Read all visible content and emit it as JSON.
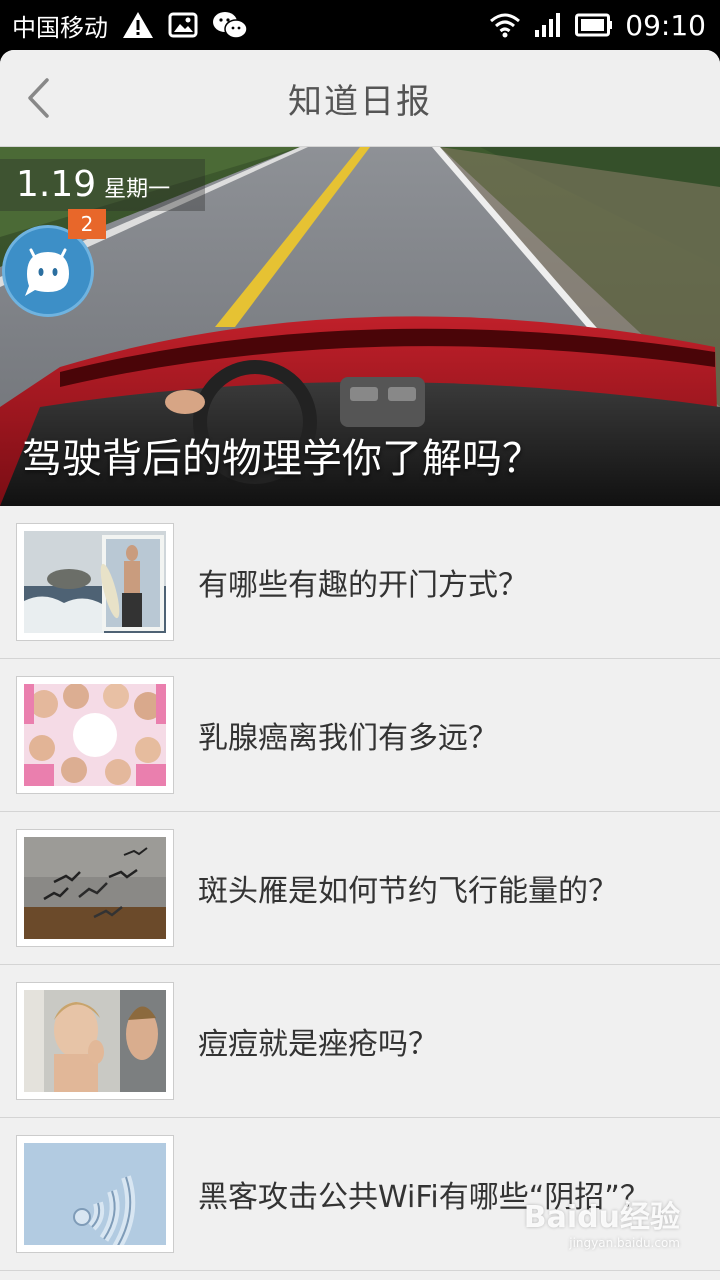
{
  "status_bar": {
    "carrier": "中国移动",
    "time": "09:10",
    "icons": [
      "warning-icon",
      "image-icon",
      "wechat-icon",
      "wifi-icon",
      "signal-icon",
      "battery-icon"
    ]
  },
  "header": {
    "title": "知道日报",
    "back_icon": "back-chevron-icon"
  },
  "hero": {
    "date": "1.19",
    "weekday": "星期一",
    "badge_count": "2",
    "title": "驾驶背后的物理学你了解吗？"
  },
  "articles": [
    {
      "title": "有哪些有趣的开门方式？",
      "thumb": "beach-door"
    },
    {
      "title": "乳腺癌离我们有多远？",
      "thumb": "women-circle"
    },
    {
      "title": "斑头雁是如何节约飞行能量的？",
      "thumb": "geese"
    },
    {
      "title": "痘痘就是痤疮吗？",
      "thumb": "mirror-face"
    },
    {
      "title": "黑客攻击公共WiFi有哪些“阴招”？",
      "thumb": "wifi-sand"
    }
  ],
  "watermark": {
    "logo": "Baidu经验",
    "url": "jingyan.baidu.com"
  },
  "colors": {
    "badge": "#e8672a",
    "avatar": "#3d8fc7",
    "list_bg": "#f0f0f0",
    "divider": "#d4d4d4"
  }
}
